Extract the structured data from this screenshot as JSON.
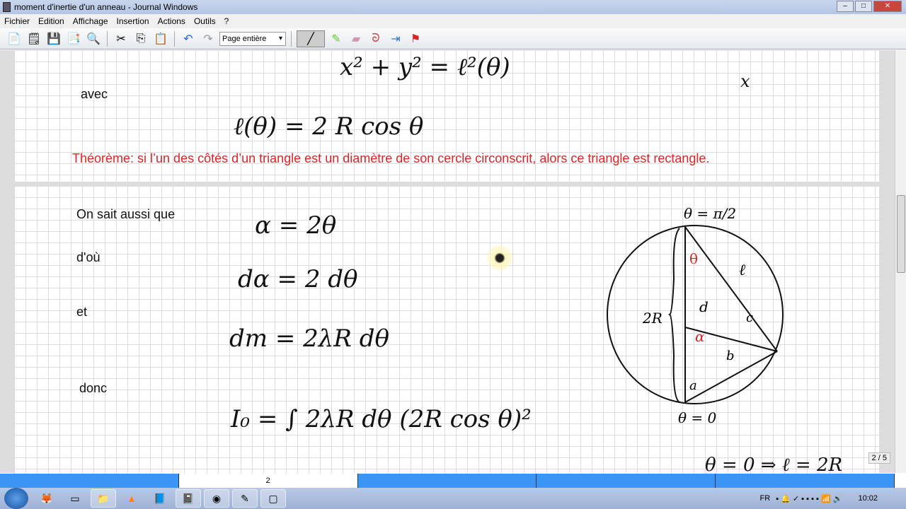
{
  "window": {
    "title": "moment d'inertie d'un anneau - Journal Windows"
  },
  "menu": [
    "Fichier",
    "Edition",
    "Affichage",
    "Insertion",
    "Actions",
    "Outils",
    "?"
  ],
  "toolbar": {
    "zoom_value": "Page entière"
  },
  "page1": {
    "eq1": "x² + y² = ℓ²(θ)",
    "avec": "avec",
    "eq2": "ℓ(θ) = 2 R cos θ",
    "axis_x": "x",
    "theorem": "Théorème: si l’un des côtés d’un triangle est un diamètre de son cercle circonscrit, alors ce triangle est rectangle."
  },
  "page2": {
    "label1": "On sait aussi  que",
    "label2": "d'où",
    "label3": "et",
    "label4": "donc",
    "eq1": "α = 2θ",
    "eq2": "dα = 2 dθ",
    "eq3": "dm = 2λR dθ",
    "eq4": "I₀ = ∫ 2λR dθ (2R cos θ)²",
    "diagram": {
      "top": "θ = π/2",
      "bottom": "θ = 0",
      "diameter": "2R",
      "l": "ℓ",
      "theta": "θ",
      "d": "d",
      "alpha": "α",
      "c": "c",
      "b": "b",
      "a": "a"
    },
    "partial": "θ = 0  ⇒  ℓ = 2R"
  },
  "page_indicator": "2 / 5",
  "pagebar": [
    "",
    "2",
    "",
    "",
    ""
  ],
  "taskbar": {
    "lang": "FR",
    "clock": "10:02"
  }
}
